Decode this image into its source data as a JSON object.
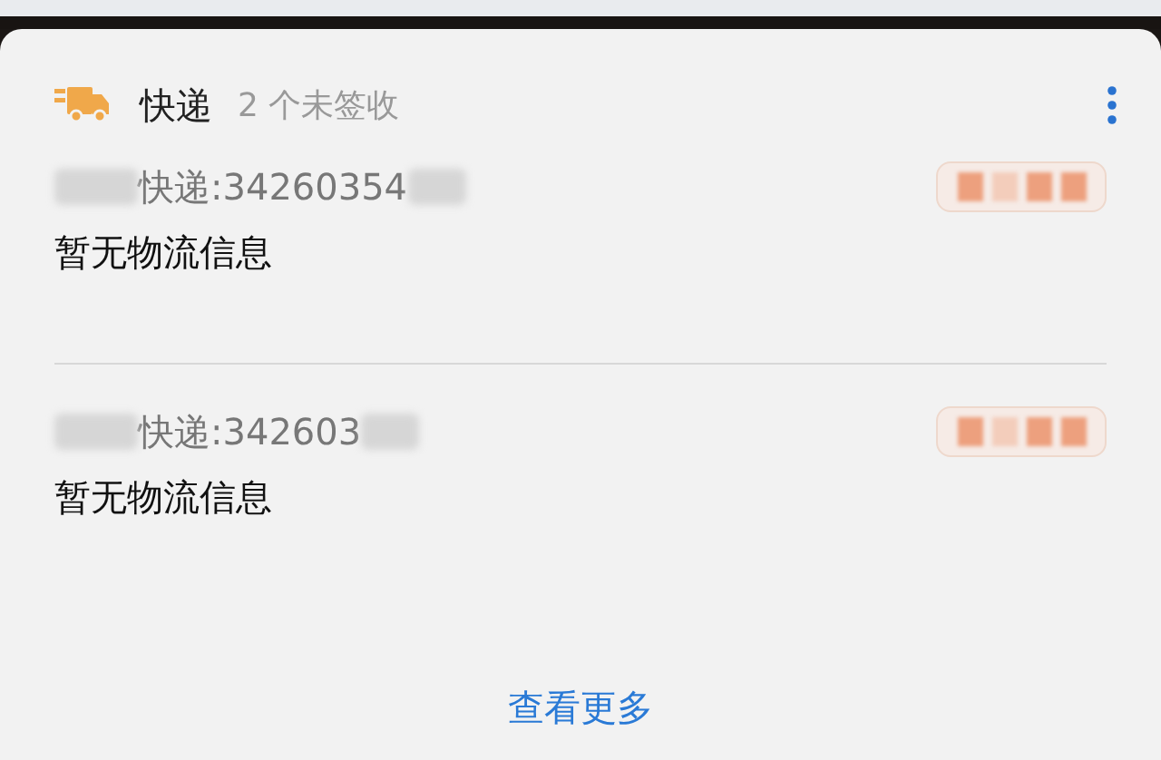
{
  "card": {
    "title": "快递",
    "subtitle": "2 个未签收"
  },
  "parcels": [
    {
      "tracking": "快递:34260354",
      "status": "暂无物流信息"
    },
    {
      "tracking": "快递:342603",
      "status": "暂无物流信息"
    }
  ],
  "more_link": "查看更多"
}
